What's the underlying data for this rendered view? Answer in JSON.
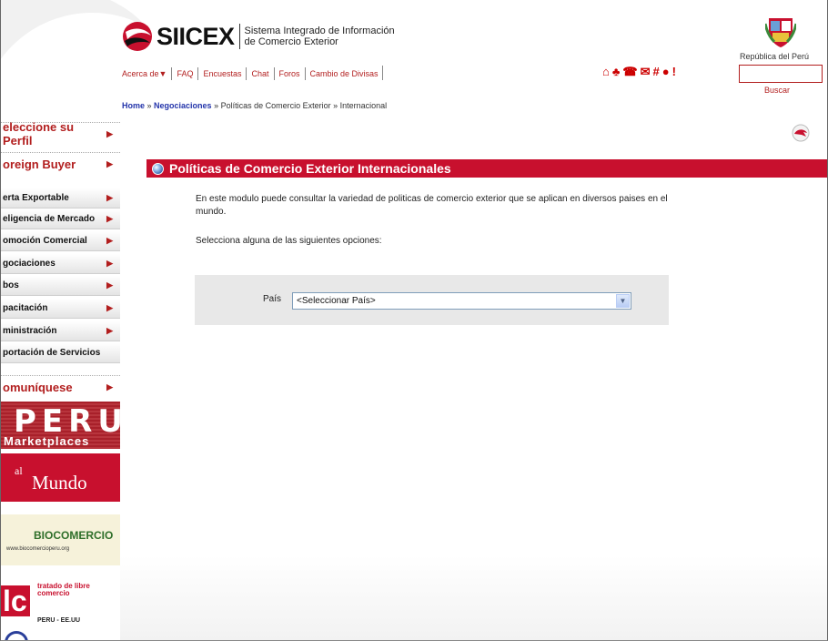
{
  "header": {
    "logo_word": "SIICEX",
    "logo_sub_line1": "Sistema Integrado de Información",
    "logo_sub_line2": "de Comercio Exterior",
    "republica": "República del Perú"
  },
  "topnav": {
    "items": [
      "Acerca de▼",
      "FAQ",
      "Encuestas",
      "Chat",
      "Foros",
      "Cambio de Divisas"
    ]
  },
  "tools": {
    "icons": [
      "home-icon",
      "sitemap-icon",
      "phone-icon",
      "mail-icon",
      "grid-icon",
      "help-icon",
      "alert-icon"
    ]
  },
  "search": {
    "value": "",
    "button": "Buscar"
  },
  "breadcrumb": {
    "home": "Home",
    "sep1": " » ",
    "negociaciones": "Negociaciones",
    "sep2": " » ",
    "rest": "Políticas de Comercio Exterior » Internacional"
  },
  "sidebar": {
    "perfil": "eleccione su Perfil",
    "buyer": "oreign Buyer",
    "items": [
      "erta Exportable",
      "eligencia de Mercado",
      "omoción Comercial",
      "gociaciones",
      "bos",
      "pacitación",
      "ministración",
      "portación de Servicios"
    ],
    "comuniquese": "omuníquese"
  },
  "banners": {
    "peru_big": "PERU",
    "peru_small": "Marketplaces",
    "mundo_al": "al",
    "mundo": "Mundo",
    "bio": "BIOCOMERCIO",
    "bio_url": "www.biocomercioperu.org",
    "tlc": "lc",
    "tlc_text": "tratado de libre comercio",
    "tlc_sub": "PERU - EE.UU"
  },
  "main": {
    "title": "Políticas de Comercio Exterior Internacionales",
    "intro": "En este modulo puede consultar la variedad de politicas de comercio exterior que se aplican en diversos paises en el mundo.",
    "prompt": "Selecciona alguna de las siguientes opciones:",
    "country_label": "País",
    "country_value": "<Seleccionar País>"
  },
  "colors": {
    "accent": "#c8102e",
    "link": "#b21e1e"
  }
}
